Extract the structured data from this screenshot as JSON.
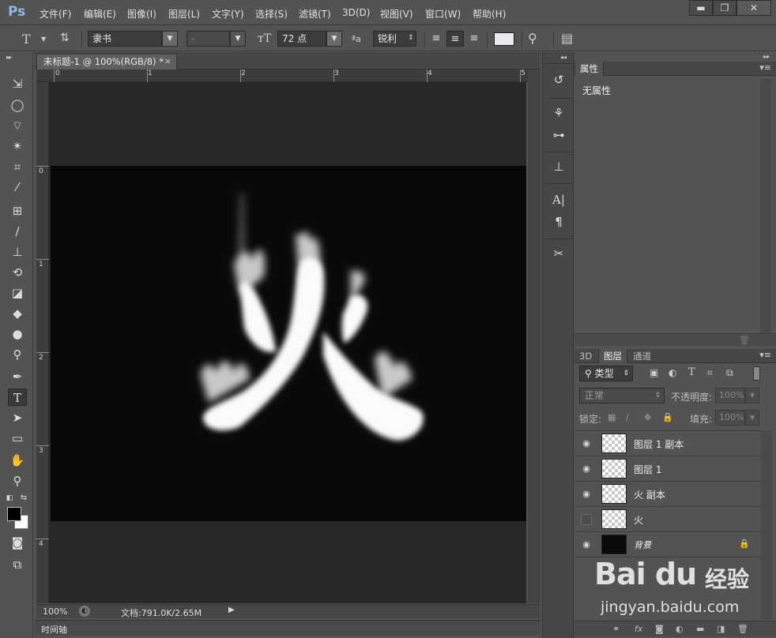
{
  "app": {
    "logo": "Ps"
  },
  "menu": [
    "文件(F)",
    "编辑(E)",
    "图像(I)",
    "图层(L)",
    "文字(Y)",
    "选择(S)",
    "滤镜(T)",
    "3D(D)",
    "视图(V)",
    "窗口(W)",
    "帮助(H)"
  ],
  "window_controls": {
    "minimize": "▬",
    "maximize": "❐",
    "close": "✕"
  },
  "options": {
    "font_family": "隶书",
    "font_style": "-",
    "font_size": "72 点",
    "aa_icon_text": "ªa",
    "antialias": "锐利",
    "text_color": "#e9e9ee"
  },
  "document": {
    "tab_title": "未标题-1 @ 100%(RGB/8) *",
    "tab_close": "×",
    "zoom": "100%",
    "doc_info": "文档:791.0K/2.65M",
    "ruler_h": [
      "0",
      "1",
      "2",
      "3",
      "4",
      "5"
    ],
    "ruler_v": [
      "0",
      "1",
      "2",
      "3",
      "4"
    ],
    "canvas_text": "火"
  },
  "timeline": {
    "label": "时间轴"
  },
  "properties_panel": {
    "tab": "属性",
    "content": "无属性"
  },
  "layers_panel": {
    "tabs": [
      "3D",
      "图层",
      "通道"
    ],
    "active_tab": "图层",
    "filter_kind": "类型",
    "blend_mode": "正常",
    "opacity_label": "不透明度:",
    "opacity_value": "100%",
    "lock_label": "锁定:",
    "fill_label": "填充:",
    "fill_value": "100%",
    "layers": [
      {
        "name": "图层 1 副本",
        "visible": true
      },
      {
        "name": "图层 1",
        "visible": true
      },
      {
        "name": "火 副本",
        "visible": true
      },
      {
        "name": "火",
        "visible": false
      },
      {
        "name": "背景",
        "visible": true,
        "locked": true
      }
    ]
  },
  "watermark": {
    "logo": "Bai du",
    "brand": "经验",
    "url": "jingyan.baidu.com"
  }
}
